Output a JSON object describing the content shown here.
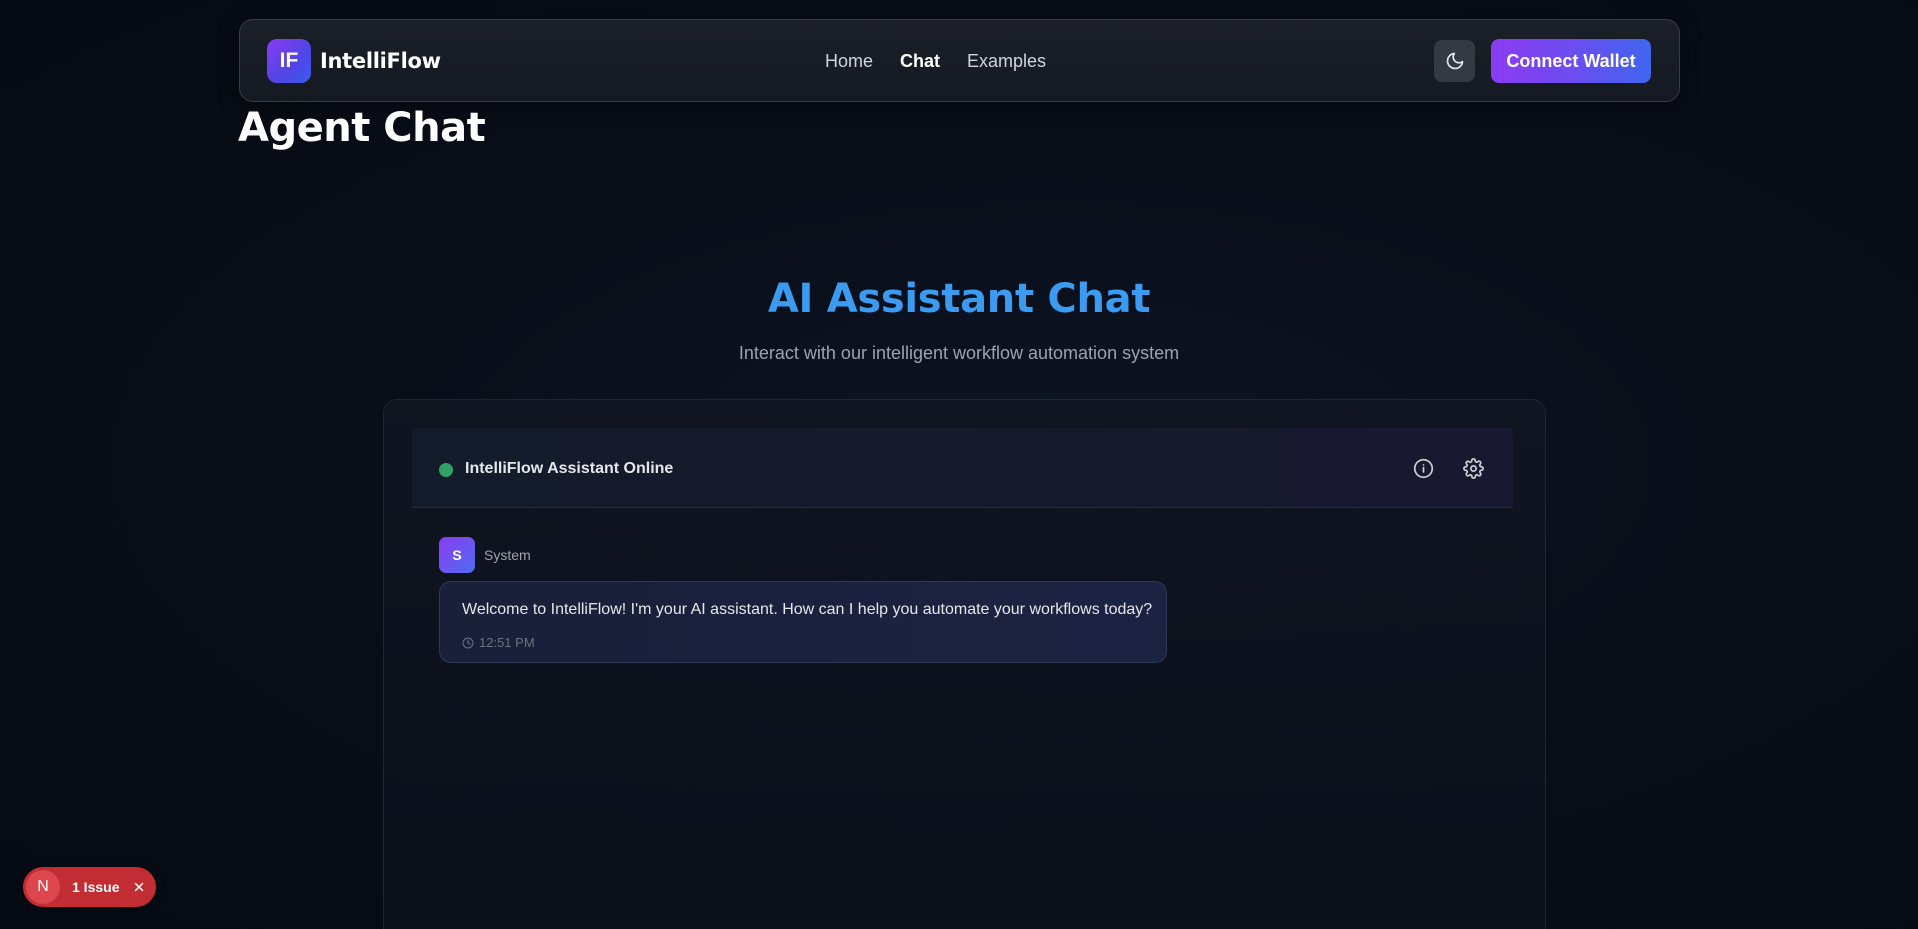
{
  "navbar": {
    "logo_initials": "IF",
    "brand_name": "IntelliFlow",
    "links": [
      "Home",
      "Chat",
      "Examples"
    ],
    "active_link": "Chat",
    "theme_icon": "moon-icon",
    "connect_label": "Connect Wallet"
  },
  "page": {
    "title": "Agent Chat"
  },
  "hero": {
    "title": "AI Assistant Chat",
    "subtitle": "Interact with our intelligent workflow automation system"
  },
  "chat": {
    "status_text": "IntelliFlow Assistant Online",
    "status_color": "#2fa266",
    "header_icons": [
      "info-icon",
      "gear-icon"
    ],
    "messages": [
      {
        "avatar": "S",
        "sender": "System",
        "text": "Welcome to IntelliFlow! I'm your AI assistant. How can I help you automate your workflows today?",
        "time": "12:51 PM"
      }
    ]
  },
  "issue_badge": {
    "letter": "N",
    "label": "1 Issue"
  },
  "colors": {
    "accent_purple": "#8b3cf2",
    "accent_blue": "#3b9bf0",
    "issue_red": "#c22c33"
  }
}
